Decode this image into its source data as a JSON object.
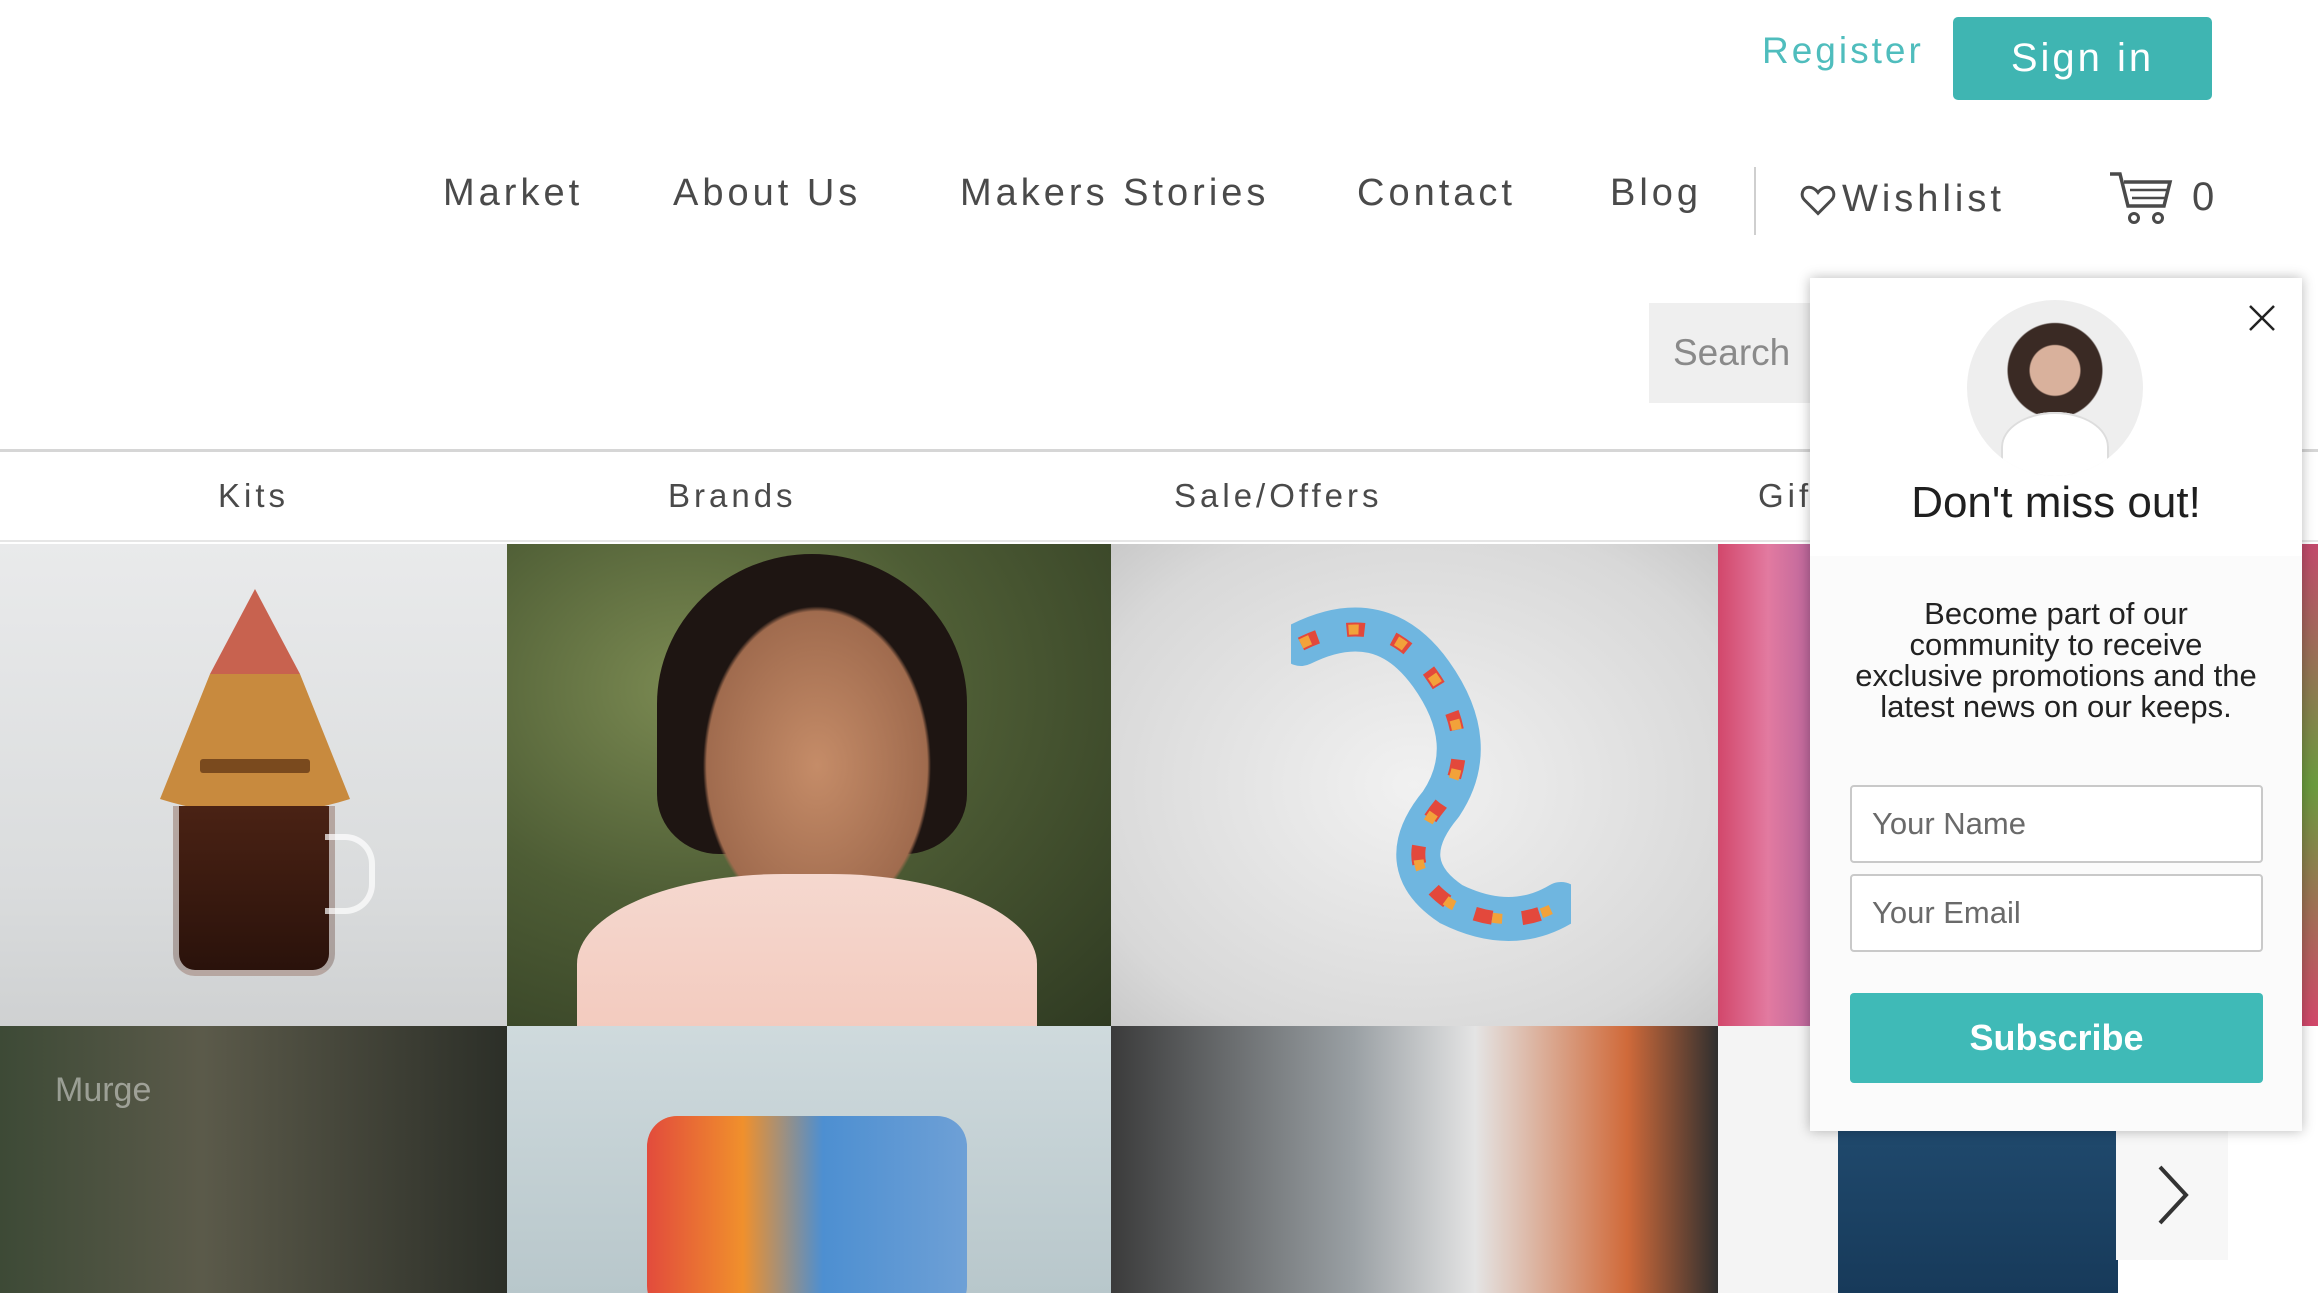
{
  "header": {
    "register_label": "Register",
    "signin_label": "Sign in"
  },
  "nav": {
    "items": [
      {
        "label": "Market"
      },
      {
        "label": "About Us"
      },
      {
        "label": "Makers Stories"
      },
      {
        "label": "Contact"
      },
      {
        "label": "Blog"
      }
    ],
    "wishlist_label": "Wishlist",
    "wishlist_icon": "heart-icon",
    "cart_icon": "cart-icon",
    "cart_count": "0"
  },
  "search": {
    "placeholder": "Search"
  },
  "subnav": {
    "items": [
      {
        "label": "Kits"
      },
      {
        "label": "Brands"
      },
      {
        "label": "Sale/Offers"
      },
      {
        "label": "Gif"
      }
    ]
  },
  "tiles": {
    "overlay_text": "Murge",
    "next_icon": "chevron-right-icon"
  },
  "popup": {
    "close_icon": "close-icon",
    "title": "Don't miss out!",
    "body": "Become part of our community to receive exclusive promotions and the latest news on our keeps.",
    "name_placeholder": "Your Name",
    "email_placeholder": "Your Email",
    "subscribe_label": "Subscribe",
    "accent_color": "#3fbab7"
  },
  "colors": {
    "brand_teal": "#3fb5b2",
    "text": "#4a4a4a"
  }
}
